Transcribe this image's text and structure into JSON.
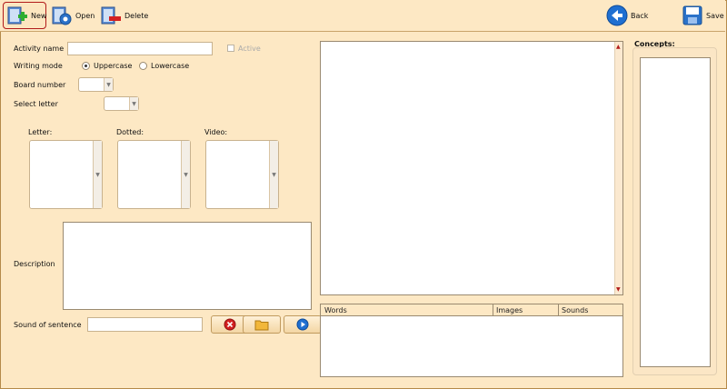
{
  "toolbar": {
    "new_label": "New",
    "open_label": "Open",
    "delete_label": "Delete",
    "back_label": "Back",
    "save_label": "Save"
  },
  "form": {
    "activity_name_label": "Activity name",
    "activity_name_value": "",
    "active_label": "Active",
    "writing_mode_label": "Writing mode",
    "uppercase_label": "Uppercase",
    "lowercase_label": "Lowercase",
    "board_number_label": "Board number",
    "select_letter_label": "Select letter",
    "letter_label": "Letter:",
    "dotted_label": "Dotted:",
    "video_label": "Video:",
    "description_label": "Description",
    "sound_label": "Sound of sentence"
  },
  "table": {
    "columns": [
      "Words",
      "Images",
      "Sounds"
    ]
  },
  "concepts": {
    "title": "Concepts:"
  },
  "colors": {
    "background": "#fde8c4",
    "accent_border": "#b11a1a",
    "back_icon": "#1f6fd1",
    "delete_red": "#d32020"
  }
}
